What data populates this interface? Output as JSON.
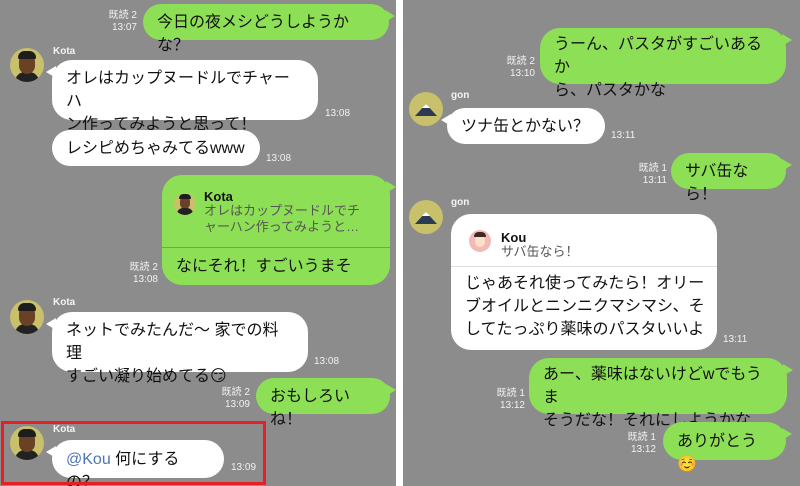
{
  "left": {
    "m1": {
      "read": "既読 2",
      "time": "13:07",
      "text": "今日の夜メシどうしようかな？"
    },
    "m2": {
      "sender": "Kota",
      "text": "オレはカップヌードルでチャーハ\nン作ってみようと思って！",
      "time": "13:08"
    },
    "m3": {
      "text": "レシピめちゃみてるwww",
      "time": "13:08"
    },
    "m4": {
      "read": "既読 2",
      "time": "13:08",
      "quote_name": "Kota",
      "quote_text": "オレはカップヌードルでチ\nャーハン作ってみようと…",
      "text": "なにそれ！すごいうまそ"
    },
    "m5": {
      "sender": "Kota",
      "text": "ネットでみたんだ〜 家での料理\nすごい凝り始めてる😏",
      "time": "13:08"
    },
    "m6": {
      "read": "既読 2",
      "time": "13:09",
      "text": "おもしろいね！"
    },
    "m7": {
      "sender": "Kota",
      "mention": "@Kou",
      "text": " 何にするの？",
      "time": "13:09"
    }
  },
  "right": {
    "r1": {
      "read": "既読 2",
      "time": "13:10",
      "text": "うーん、パスタがすごいあるか\nら、パスタかな"
    },
    "r2": {
      "sender": "gon",
      "text": "ツナ缶とかない？",
      "time": "13:11"
    },
    "r3": {
      "read": "既読 1",
      "time": "13:11",
      "text": "サバ缶なら！"
    },
    "r4": {
      "sender": "gon",
      "quote_name": "Kou",
      "quote_text": "サバ缶なら！",
      "text": "じゃあそれ使ってみたら！オリー\nブオイルとニンニクマシマシ、そ\nしてたっぷり薬味のパスタいいよ",
      "time": "13:11"
    },
    "r5": {
      "read": "既読 1",
      "time": "13:12",
      "text": "あー、薬味はないけどwでもうま\nそうだな！それにしようかな"
    },
    "r6": {
      "read": "既読 1",
      "time": "13:12",
      "text": "ありがとう☺️"
    }
  }
}
